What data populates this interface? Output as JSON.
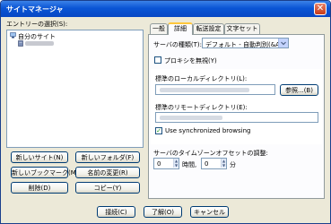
{
  "window": {
    "title": "サイトマネージャ",
    "close_glyph": "✕"
  },
  "left": {
    "entries_label": "エントリーの選択(S):",
    "tree": {
      "root_label": "自分のサイト"
    }
  },
  "buttons": {
    "new_site": "新しいサイト(N)",
    "new_folder": "新しいフォルダ(F)",
    "new_bookmark": "新しいブックマーク(M)",
    "rename": "名前の変更(R)",
    "delete": "削除(D)",
    "copy": "コピー(Y)",
    "connect": "接続(C)",
    "ok": "了解(O)",
    "cancel": "キャンセル"
  },
  "tabs": [
    "一般",
    "詳細",
    "転送設定",
    "文字セット"
  ],
  "advanced": {
    "server_type_label": "サーバの種類(T):",
    "server_type_value": "デフォルト - 自動判別(&A)",
    "bypass_proxy_label": "プロキシを無視(Y)",
    "bypass_proxy_checked": false,
    "local_dir_label": "標準のローカルディレクトリ(L):",
    "browse_label": "参照...(B)",
    "remote_dir_label": "標準のリモートディレクトリ(E):",
    "sync_label": "Use synchronized browsing",
    "sync_checked": true,
    "tz_label": "サーバのタイムゾーンオフセットの調整:",
    "hours_value": "0",
    "hours_label": "時間,",
    "minutes_value": "0",
    "minutes_label": "分"
  },
  "icons": [
    "close-icon",
    "computer-icon",
    "server-icon",
    "dropdown-arrow-icon",
    "spin-up-icon",
    "spin-down-icon",
    "checkmark-icon"
  ],
  "colors": {
    "titlebar": "#0a55d5",
    "dialog_bg": "#ece9d8",
    "tab_highlight": "#ffc73c",
    "checkmark": "#21a121"
  }
}
